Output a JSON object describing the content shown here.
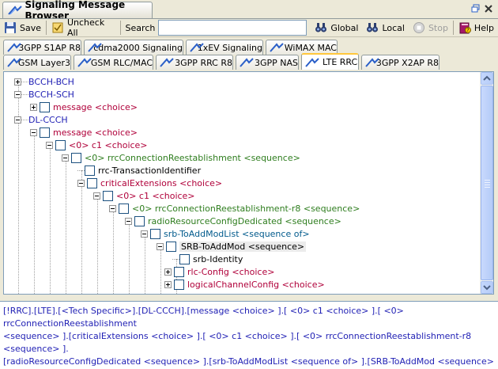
{
  "window": {
    "title": "Signaling Message Browser"
  },
  "toolbar": {
    "save_label": "Save",
    "uncheck_all_label": "Uncheck All",
    "search_label": "Search",
    "search_value": "",
    "global_label": "Global",
    "local_label": "Local",
    "stop_label": "Stop",
    "help_label": "Help"
  },
  "tabs_row1": [
    "3GPP S1AP R8",
    "cdma2000 Signaling",
    "1xEV Signaling",
    "WiMAX MAC"
  ],
  "tabs_row2": [
    "GSM Layer3",
    "GSM RLC/MAC",
    "3GPP RRC R8",
    "3GPP NAS",
    "LTE RRC",
    "3GPP X2AP R8"
  ],
  "active_tab": "LTE RRC",
  "tree": [
    {
      "label": "BCCH-BCH",
      "color": "#1f1fb4"
    },
    {
      "label": "BCCH-SCH",
      "color": "#1f1fb4"
    },
    {
      "label": "message <choice>",
      "color": "#b0003a"
    },
    {
      "label": "DL-CCCH",
      "color": "#1f1fb4"
    },
    {
      "label": "message <choice>",
      "color": "#b0003a"
    },
    {
      "label": "<0> c1 <choice>",
      "color": "#b0003a"
    },
    {
      "label": "<0> rrcConnectionReestablishment <sequence>",
      "color": "#2e7d1e"
    },
    {
      "label": "rrc-TransactionIdentifier",
      "color": "#000000"
    },
    {
      "label": "criticalExtensions <choice>",
      "color": "#b0003a"
    },
    {
      "label": "<0> c1 <choice>",
      "color": "#b0003a"
    },
    {
      "label": "<0> rrcConnectionReestablishment-r8 <sequence>",
      "color": "#2e7d1e"
    },
    {
      "label": "radioResourceConfigDedicated <sequence>",
      "color": "#2e7d1e"
    },
    {
      "label": "srb-ToAddModList <sequence of>",
      "color": "#005a8c"
    },
    {
      "label": "SRB-ToAddMod <sequence>",
      "color": "#000000"
    },
    {
      "label": "srb-Identity",
      "color": "#000000"
    },
    {
      "label": "rlc-Config <choice>",
      "color": "#b0003a"
    },
    {
      "label": "logicalChannelConfig <choice>",
      "color": "#b0003a"
    }
  ],
  "status_lines": [
    "[!RRC].[LTE].[<Tech Specific>].[DL-CCCH].[message <choice> ].[ <0> c1 <choice> ].[ <0> rrcConnectionReestablishment",
    "<sequence> ].[criticalExtensions <choice> ].[ <0> c1 <choice> ].[ <0> rrcConnectionReestablishment-r8 <sequence> ].",
    "[radioResourceConfigDedicated <sequence> ].[srb-ToAddModList <sequence of> ].[SRB-ToAddMod <sequence> ]"
  ]
}
